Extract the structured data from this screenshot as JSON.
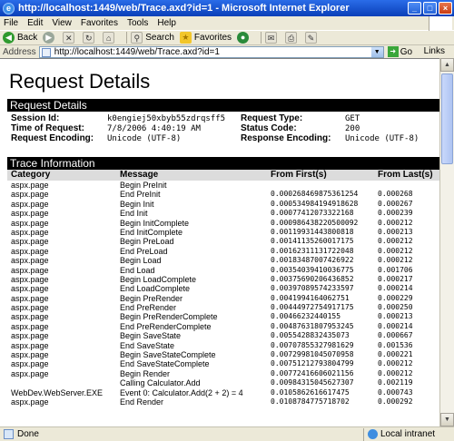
{
  "window": {
    "title": "http://localhost:1449/web/Trace.axd?id=1 - Microsoft Internet Explorer"
  },
  "menu": {
    "items": [
      "File",
      "Edit",
      "View",
      "Favorites",
      "Tools",
      "Help"
    ]
  },
  "toolbar": {
    "back": "Back",
    "search": "Search",
    "favorites": "Favorites"
  },
  "address": {
    "label": "Address",
    "url": "http://localhost:1449/web/Trace.axd?id=1",
    "go": "Go",
    "links": "Links"
  },
  "page": {
    "title": "Request Details",
    "section1": "Request Details",
    "section2": "Trace Information",
    "details": [
      {
        "key": "Session Id:",
        "value": "k0engiej50xbyb55zdrqsff5"
      },
      {
        "key": "Time of Request:",
        "value": "7/8/2006 4:40:19 AM"
      },
      {
        "key": "Request Encoding:",
        "value": "Unicode (UTF-8)"
      },
      {
        "key": "Request Type:",
        "value": "GET"
      },
      {
        "key": "Status Code:",
        "value": "200"
      },
      {
        "key": "Response Encoding:",
        "value": "Unicode (UTF-8)"
      }
    ],
    "trace": {
      "headers": [
        "Category",
        "Message",
        "From First(s)",
        "From Last(s)"
      ],
      "rows": [
        [
          "aspx.page",
          "Begin PreInit",
          "",
          ""
        ],
        [
          "aspx.page",
          "End PreInit",
          "0.000268469875361254",
          "0.000268"
        ],
        [
          "aspx.page",
          "Begin Init",
          "0.000534984194918628",
          "0.000267"
        ],
        [
          "aspx.page",
          "End Init",
          "0.00077412073322168",
          "0.000239"
        ],
        [
          "aspx.page",
          "Begin InitComplete",
          "0.000986438220500092",
          "0.000212"
        ],
        [
          "aspx.page",
          "End InitComplete",
          "0.00119931443800818",
          "0.000213"
        ],
        [
          "aspx.page",
          "Begin PreLoad",
          "0.00141135260017175",
          "0.000212"
        ],
        [
          "aspx.page",
          "End PreLoad",
          "0.00162311131722048",
          "0.000212"
        ],
        [
          "aspx.page",
          "Begin Load",
          "0.00183487007426922",
          "0.000212"
        ],
        [
          "aspx.page",
          "End Load",
          "0.00354039410036775",
          "0.001706"
        ],
        [
          "aspx.page",
          "Begin LoadComplete",
          "0.00375690206436852",
          "0.000217"
        ],
        [
          "aspx.page",
          "End LoadComplete",
          "0.00397089574233597",
          "0.000214"
        ],
        [
          "aspx.page",
          "Begin PreRender",
          "0.0041994164062751",
          "0.000229"
        ],
        [
          "aspx.page",
          "End PreRender",
          "0.00444972754917175",
          "0.000250"
        ],
        [
          "aspx.page",
          "Begin PreRenderComplete",
          "0.00466232440155",
          "0.000213"
        ],
        [
          "aspx.page",
          "End PreRenderComplete",
          "0.00487631807953245",
          "0.000214"
        ],
        [
          "aspx.page",
          "Begin SaveState",
          "0.0055428832435073",
          "0.000667"
        ],
        [
          "aspx.page",
          "End SaveState",
          "0.00707855327981629",
          "0.001536"
        ],
        [
          "aspx.page",
          "Begin SaveStateComplete",
          "0.00729981045070958",
          "0.000221"
        ],
        [
          "aspx.page",
          "End SaveStateComplete",
          "0.00751212793804799",
          "0.000212"
        ],
        [
          "aspx.page",
          "Begin Render",
          "0.00772416606021156",
          "0.000212"
        ],
        [
          "",
          "Calling Calculator.Add",
          "0.00984315045627307",
          "0.002119"
        ],
        [
          "WebDev.WebServer.EXE",
          "Event 0: Calculator.Add(2 + 2) = 4",
          "0.0105862616617475",
          "0.000743"
        ],
        [
          "aspx.page",
          "End Render",
          "0.0108784775718702",
          "0.000292"
        ]
      ]
    }
  },
  "status": {
    "text": "Done",
    "zone": "Local intranet"
  }
}
